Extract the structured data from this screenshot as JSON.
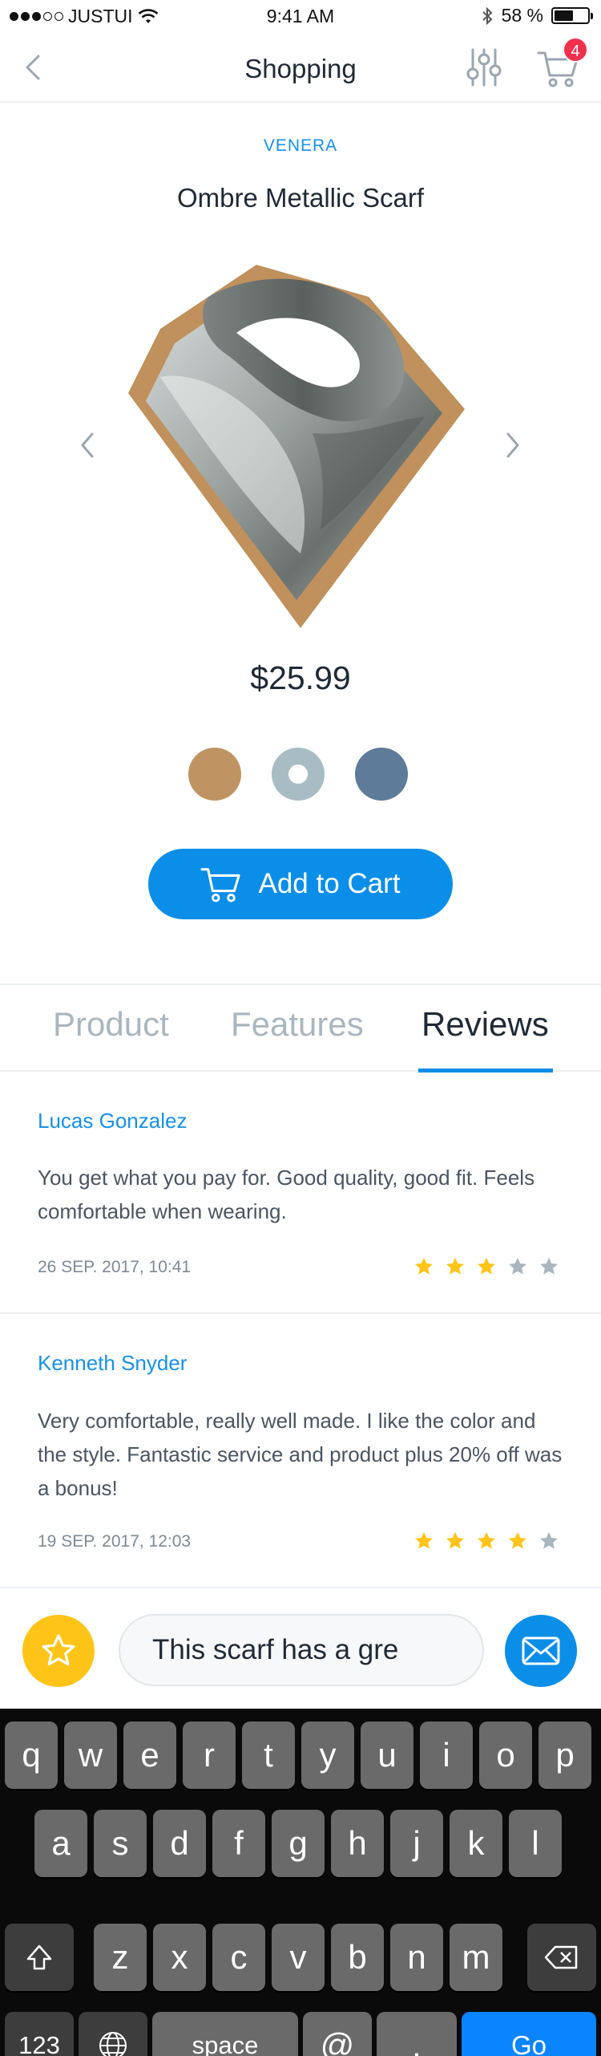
{
  "status_bar": {
    "carrier": "JUSTUI",
    "time": "9:41 AM",
    "battery": "58 %",
    "battery_level": 0.58
  },
  "nav": {
    "title": "Shopping",
    "cart_count": "4"
  },
  "product": {
    "brand": "VENERA",
    "name": "Ombre Metallic Scarf",
    "price": "$25.99",
    "add_to_cart": "Add to Cart",
    "colors": [
      "#c09462",
      "#a8bcc3",
      "#5e7b99"
    ],
    "selected_color_index": 1
  },
  "tabs": [
    {
      "label": "Product"
    },
    {
      "label": "Features"
    },
    {
      "label": "Reviews"
    }
  ],
  "active_tab": "Reviews",
  "reviews": [
    {
      "author": "Lucas Gonzalez",
      "text": "You get what you pay for. Good quality, good fit. Feels comfortable when wearing.",
      "date": "26 SEP. 2017, 10:41",
      "rating": 3,
      "max_rating": 5
    },
    {
      "author": "Kenneth Snyder",
      "text": "Very comfortable, really well made. I like the color and the style. Fantastic service and product plus 20% off was a bonus!",
      "date": "19 SEP. 2017, 12:03",
      "rating": 4,
      "max_rating": 5
    }
  ],
  "compose": {
    "value": "This scarf has a gre"
  },
  "keyboard": {
    "row1": [
      "q",
      "w",
      "e",
      "r",
      "t",
      "y",
      "u",
      "i",
      "o",
      "p"
    ],
    "row2": [
      "a",
      "s",
      "d",
      "f",
      "g",
      "h",
      "j",
      "k",
      "l"
    ],
    "row3": [
      "z",
      "x",
      "c",
      "v",
      "b",
      "n",
      "m"
    ],
    "numbers": "123",
    "space": "space",
    "at": "@",
    "dot": ".",
    "go": "Go"
  },
  "colors": {
    "accent": "#0b8ee8",
    "star_on": "#fec418",
    "star_off": "#aab6bf",
    "badge": "#f0304c"
  }
}
